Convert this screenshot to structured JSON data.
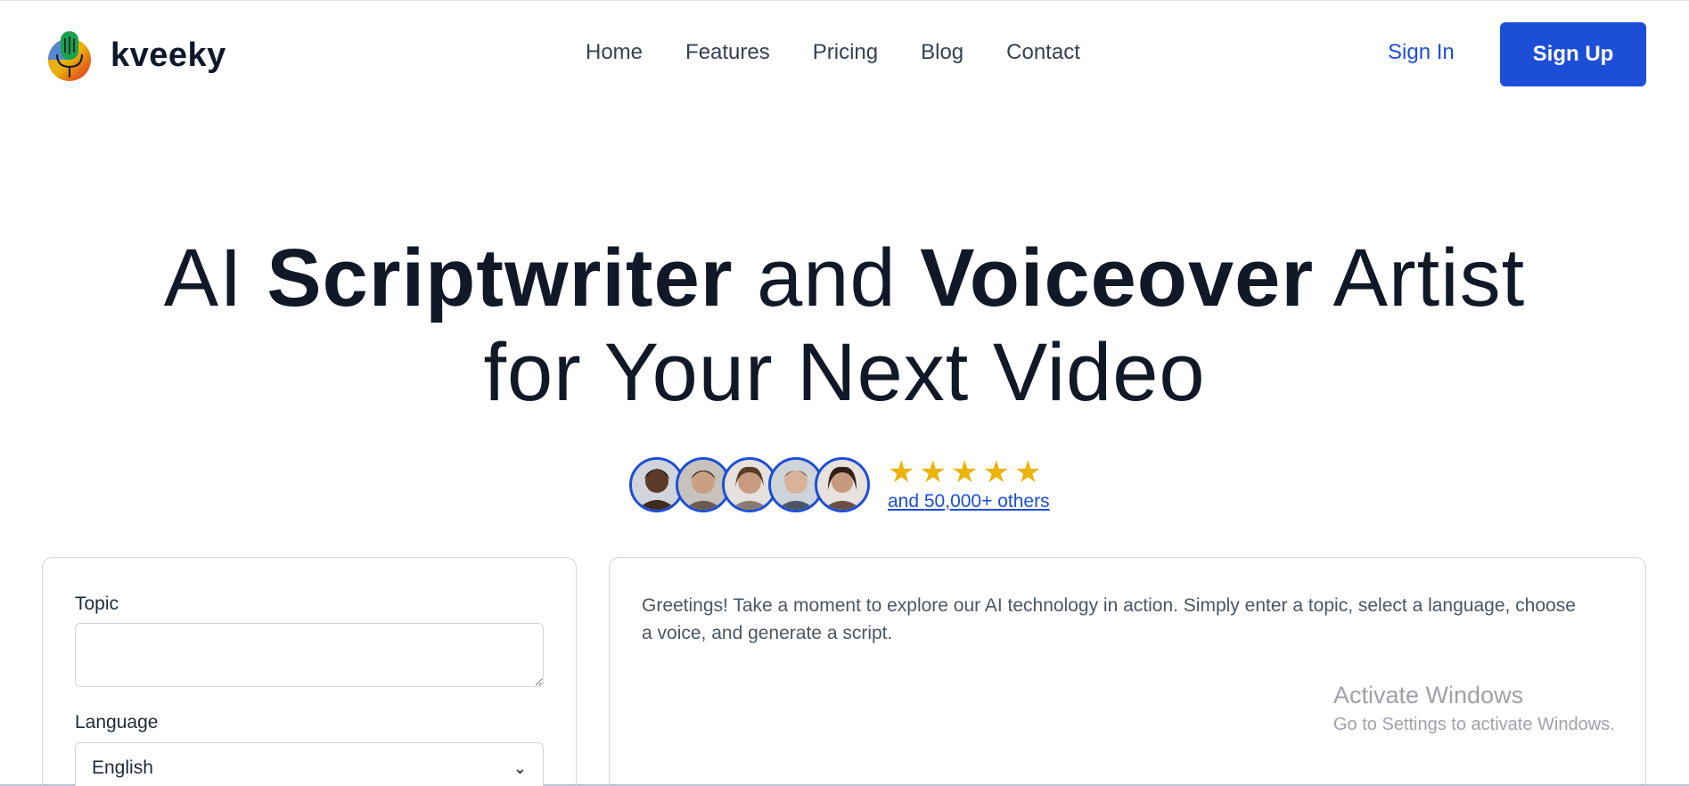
{
  "brand": {
    "name": "kveeky",
    "logo_icon": "microphone-logo-icon"
  },
  "nav": {
    "items": [
      {
        "label": "Home"
      },
      {
        "label": "Features"
      },
      {
        "label": "Pricing"
      },
      {
        "label": "Blog"
      },
      {
        "label": "Contact"
      }
    ],
    "sign_in": "Sign In",
    "sign_up": "Sign Up"
  },
  "hero": {
    "line1_a": "AI ",
    "line1_b": "Scriptwriter",
    "line1_c": " and ",
    "line1_d": "Voiceover",
    "line1_e": " Artist",
    "line2": "for Your Next Video"
  },
  "social_proof": {
    "avatars": 5,
    "stars": 5,
    "others_link": "and 50,000+ others"
  },
  "form": {
    "topic_label": "Topic",
    "topic_value": "",
    "language_label": "Language",
    "language_value": "English"
  },
  "output": {
    "intro": "Greetings! Take a moment to explore our AI technology in action. Simply enter a topic, select a language, choose a voice, and generate a script."
  },
  "watermark": {
    "title": "Activate Windows",
    "subtitle": "Go to Settings to activate Windows."
  },
  "colors": {
    "accent": "#1d4ed8",
    "star": "#eab308",
    "text": "#111827"
  }
}
